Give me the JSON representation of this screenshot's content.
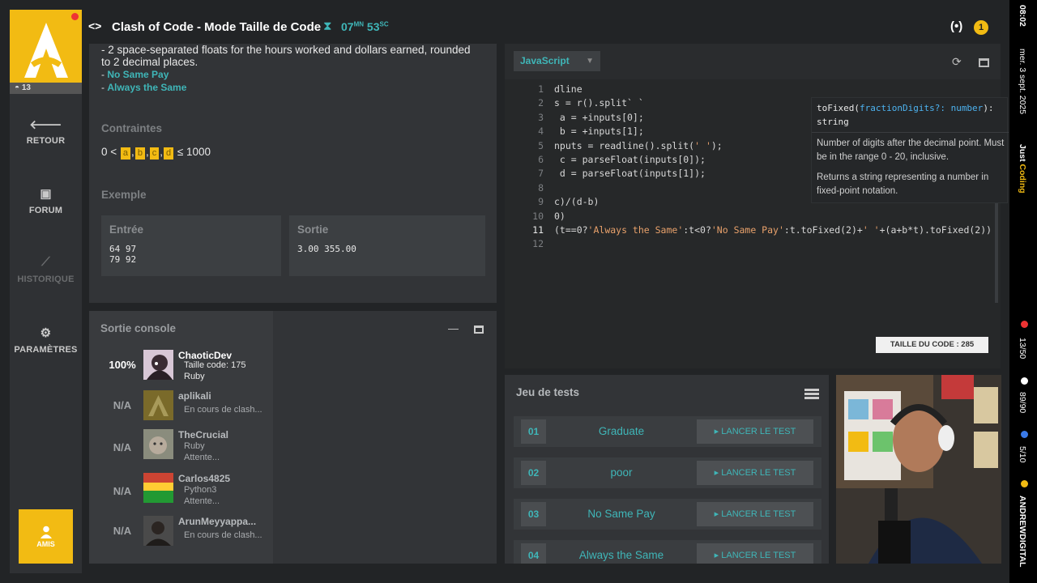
{
  "app": {
    "level": "13",
    "title": "Clash of Code - Mode Taille de Code",
    "timer_min": "07",
    "timer_min_unit": "MN",
    "timer_sec": "53",
    "timer_sec_unit": "SC",
    "notifications": "1"
  },
  "nav": {
    "back": "RETOUR",
    "forum": "FORUM",
    "history": "HISTORIQUE",
    "settings": "PARAMÈTRES",
    "friends": "AMIS"
  },
  "statement": {
    "text": "- 2 space-separated floats for the hours worked and dollars earned, rounded to 2 decimal places.",
    "item1": "No Same Pay",
    "item2": "Always the Same",
    "constraints_title": "Contraintes",
    "constraint_start": "0 <",
    "vars": [
      "a",
      "b",
      "c",
      "d"
    ],
    "constraint_end": "≤ 1000",
    "example_title": "Exemple",
    "input_label": "Entrée",
    "input_value": "64 97\n79 92",
    "output_label": "Sortie",
    "output_value": "3.00 355.00"
  },
  "console": {
    "title": "Sortie console",
    "players": [
      {
        "pct": "100%",
        "name": "ChaoticDev",
        "line1": "Taille code: 175",
        "line2": "Ruby"
      },
      {
        "pct": "N/A",
        "name": "aplikali",
        "line1": "En cours de clash...",
        "line2": ""
      },
      {
        "pct": "N/A",
        "name": "TheCrucial",
        "line1": "Ruby",
        "line2": "Attente..."
      },
      {
        "pct": "N/A",
        "name": "Carlos4825",
        "line1": "Python3",
        "line2": "Attente..."
      },
      {
        "pct": "N/A",
        "name": "ArunMeyyappa...",
        "line1": "En cours de clash...",
        "line2": ""
      }
    ]
  },
  "editor": {
    "language": "JavaScript",
    "line_numbers": [
      "1",
      "2",
      "3",
      "4",
      "5",
      "6",
      "7",
      "8",
      "9",
      "10",
      "11",
      "12"
    ],
    "lines": [
      "dline",
      "s = r().split` `",
      " a = +inputs[0];",
      " b = +inputs[1];",
      "nputs = readline().split(' ');",
      " c = parseFloat(inputs[0]);",
      " d = parseFloat(inputs[1]);",
      "",
      "c)/(d-b)",
      "0)",
      "(t==0?'Always the Same':t<0?'No Same Pay':t.toFixed(2)+' '+(a+b*t).toFixed(2))",
      ""
    ],
    "tooltip_sig_fn": "toFixed(",
    "tooltip_sig_param": "fractionDigits?: number",
    "tooltip_sig_ret": "): string",
    "tooltip_desc1": "Number of digits after the decimal point. Must be in the range 0 - 20, inclusive.",
    "tooltip_desc2": "Returns a string representing a number in fixed-point notation.",
    "code_size": "TAILLE DU CODE : 285"
  },
  "tests": {
    "title": "Jeu de tests",
    "button_label": "▸ LANCER LE TEST",
    "items": [
      {
        "num": "01",
        "name": "Graduate"
      },
      {
        "num": "02",
        "name": "poor"
      },
      {
        "num": "03",
        "name": "No Same Pay"
      },
      {
        "num": "04",
        "name": "Always the Same"
      }
    ]
  },
  "ticker": {
    "time": "08:02",
    "date": "mer. 3 sept. 2025",
    "tag_a": "Just ",
    "tag_b": "Coding",
    "stat1": "13/50",
    "stat2": "89/90",
    "stat3": "5/10",
    "channel": "ANDREWDIGITAL"
  },
  "colors": {
    "accent": "#f2bb13",
    "teal": "#3fb6b8",
    "panel": "#323437"
  }
}
